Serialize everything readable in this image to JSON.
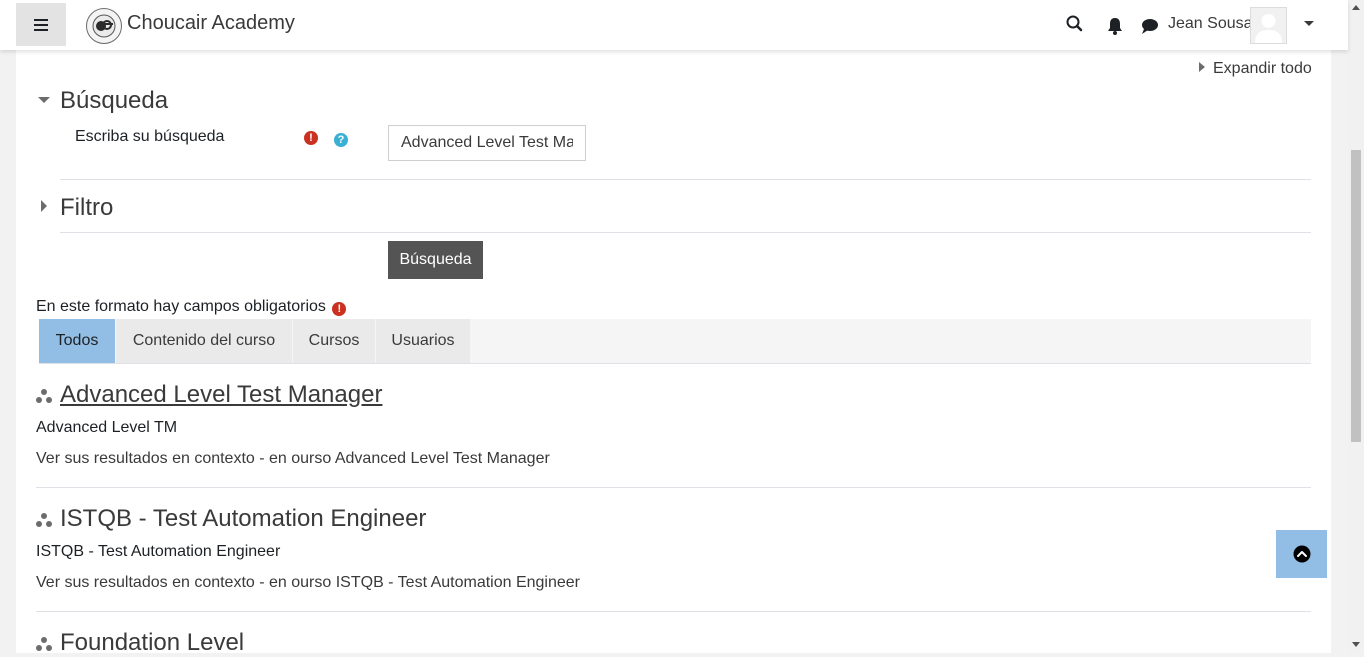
{
  "navbar": {
    "brand": "Choucair Academy",
    "user_name": "Jean Sousa",
    "icons": [
      "menu-icon",
      "search-icon",
      "bell-icon",
      "chat-icon",
      "chevron-down-icon"
    ]
  },
  "form": {
    "expand_all": "Expandir todo",
    "search_section": "Búsqueda",
    "search_label": "Escriba su búsqueda",
    "search_value": "Advanced Level Test Mar",
    "filter_section": "Filtro",
    "search_button": "Búsqueda",
    "required_note": "En este formato hay campos obligatorios"
  },
  "tabs": [
    {
      "label": "Todos",
      "active": true
    },
    {
      "label": "Contenido del curso",
      "active": false
    },
    {
      "label": "Cursos",
      "active": false
    },
    {
      "label": "Usuarios",
      "active": false
    }
  ],
  "results": [
    {
      "title": "Advanced Level Test Manager",
      "subtitle": "Advanced Level TM",
      "context": "Ver sus resultados en contexto - en ourso Advanced Level Test Manager"
    },
    {
      "title": "ISTQB - Test Automation Engineer",
      "subtitle": "ISTQB - Test Automation Engineer",
      "context": "Ver sus resultados en contexto - en ourso ISTQB - Test Automation Engineer"
    },
    {
      "title": "Foundation Level",
      "subtitle": "",
      "context": ""
    }
  ],
  "colors": {
    "active_tab": "#92bde4",
    "button": "#545454",
    "error": "#ca3120",
    "help": "#3ab0d4"
  }
}
